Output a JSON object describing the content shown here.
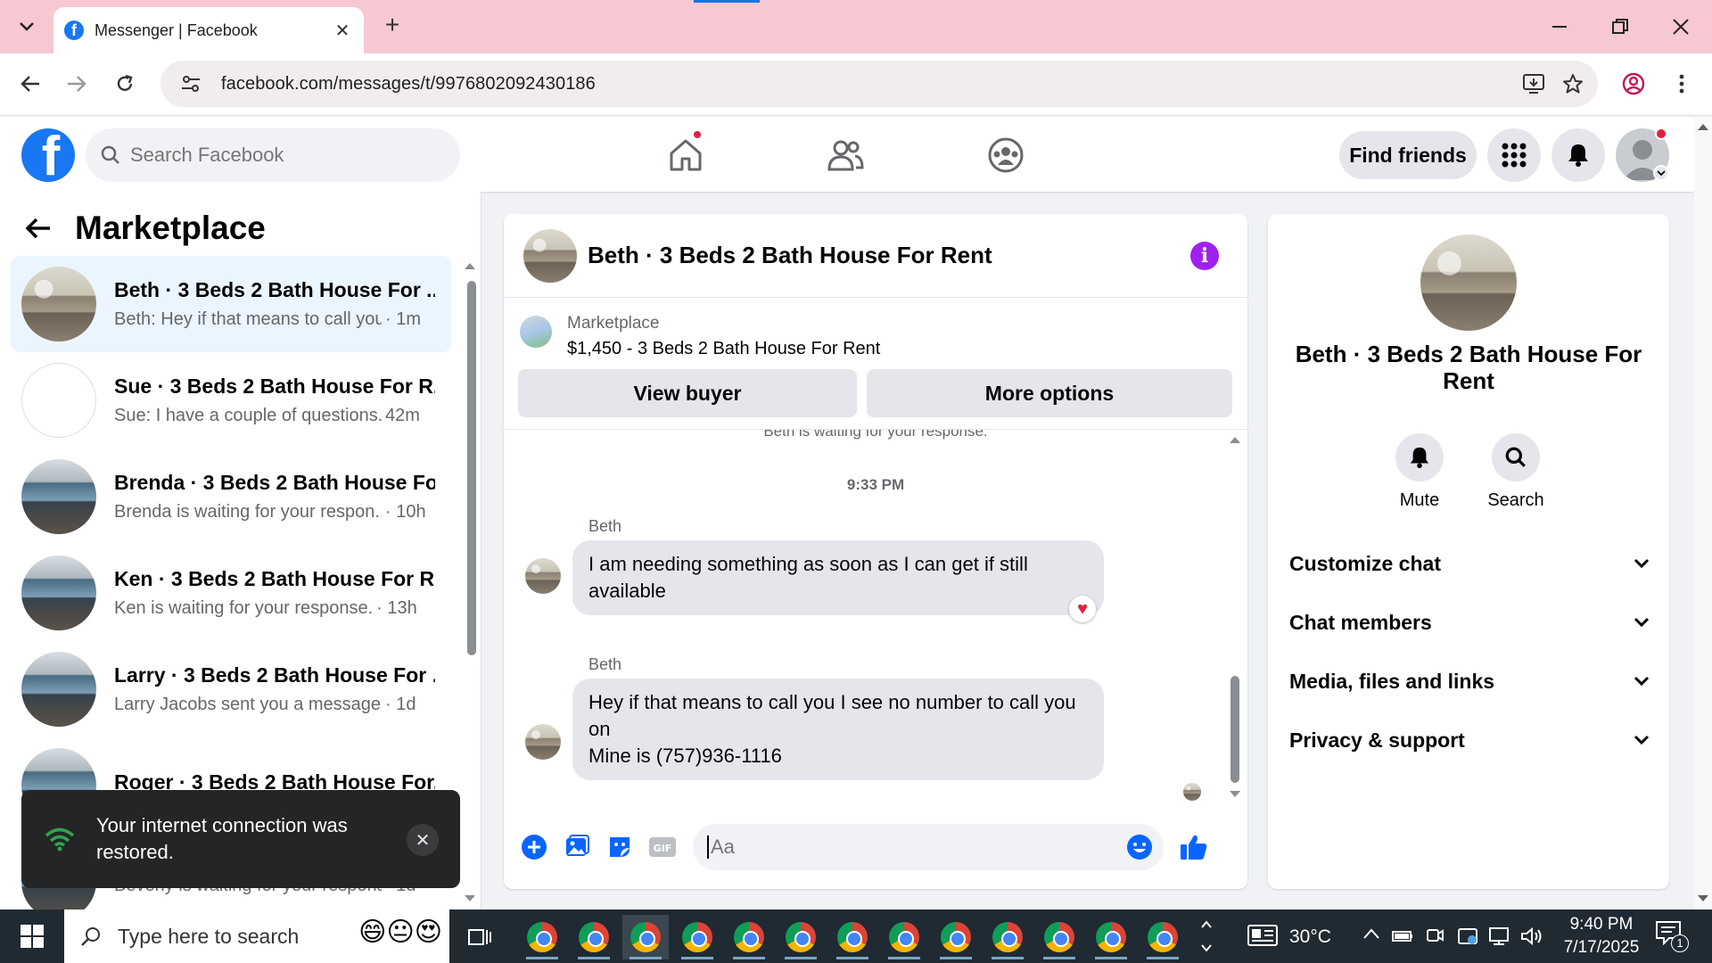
{
  "browser": {
    "tab_title": "Messenger | Facebook",
    "url": "facebook.com/messages/t/9976802092430186"
  },
  "fb": {
    "search_placeholder": "Search Facebook",
    "find_friends": "Find friends"
  },
  "left": {
    "title": "Marketplace",
    "conversations": [
      {
        "name": "Beth · 3 Beds 2 Bath House For ...",
        "preview": "Beth: Hey if that means to call you ...",
        "time": "· 1m"
      },
      {
        "name": "Sue · 3 Beds 2 Bath House For R...",
        "preview": "Sue: I have a couple of questions....",
        "time": "42m"
      },
      {
        "name": "Brenda · 3 Beds 2 Bath House Fo...",
        "preview": "Brenda is waiting for your respon...",
        "time": "· 10h"
      },
      {
        "name": "Ken · 3 Beds 2 Bath House For R...",
        "preview": "Ken is waiting for your response.",
        "time": "· 13h"
      },
      {
        "name": "Larry · 3 Beds 2 Bath House For ...",
        "preview": "Larry Jacobs sent you a message a...",
        "time": "· 1d"
      },
      {
        "name": "Roger · 3 Beds 2 Bath House For...",
        "preview": "",
        "time": ""
      },
      {
        "name": "",
        "preview": "Beverly is waiting for your response.",
        "time": "· 1d"
      }
    ],
    "toast": "Your internet connection was restored."
  },
  "chat": {
    "title": "Beth · 3 Beds 2 Bath House For Rent",
    "listing_label": "Marketplace",
    "listing_price": "$1,450 - 3 Beds 2 Bath House For Rent",
    "view_buyer": "View buyer",
    "more_options": "More options",
    "waiting_note": "Beth is waiting for your response.",
    "time_divider": "9:33 PM",
    "messages": [
      {
        "sender": "Beth",
        "text": "I am needing something as soon as I can get if still available"
      },
      {
        "sender": "Beth",
        "text_lines": [
          "Hey if that means to call you I see no number to call you on",
          "Mine is (757)936-1116"
        ]
      }
    ],
    "input_placeholder": "Aa"
  },
  "right": {
    "name": "Beth · 3 Beds 2 Bath House For Rent",
    "mute": "Mute",
    "search": "Search",
    "sections": [
      "Customize chat",
      "Chat members",
      "Media, files and links",
      "Privacy & support"
    ]
  },
  "taskbar": {
    "search_placeholder": "Type here to search",
    "weather": "30°C",
    "time": "9:40 PM",
    "date": "7/17/2025",
    "notification_count": "1"
  },
  "colors": {
    "fb_blue": "#1877f2",
    "tab_bar": "#f7c8d2",
    "active_conversation": "#ebf5ff",
    "info_purple": "#a020f0"
  }
}
